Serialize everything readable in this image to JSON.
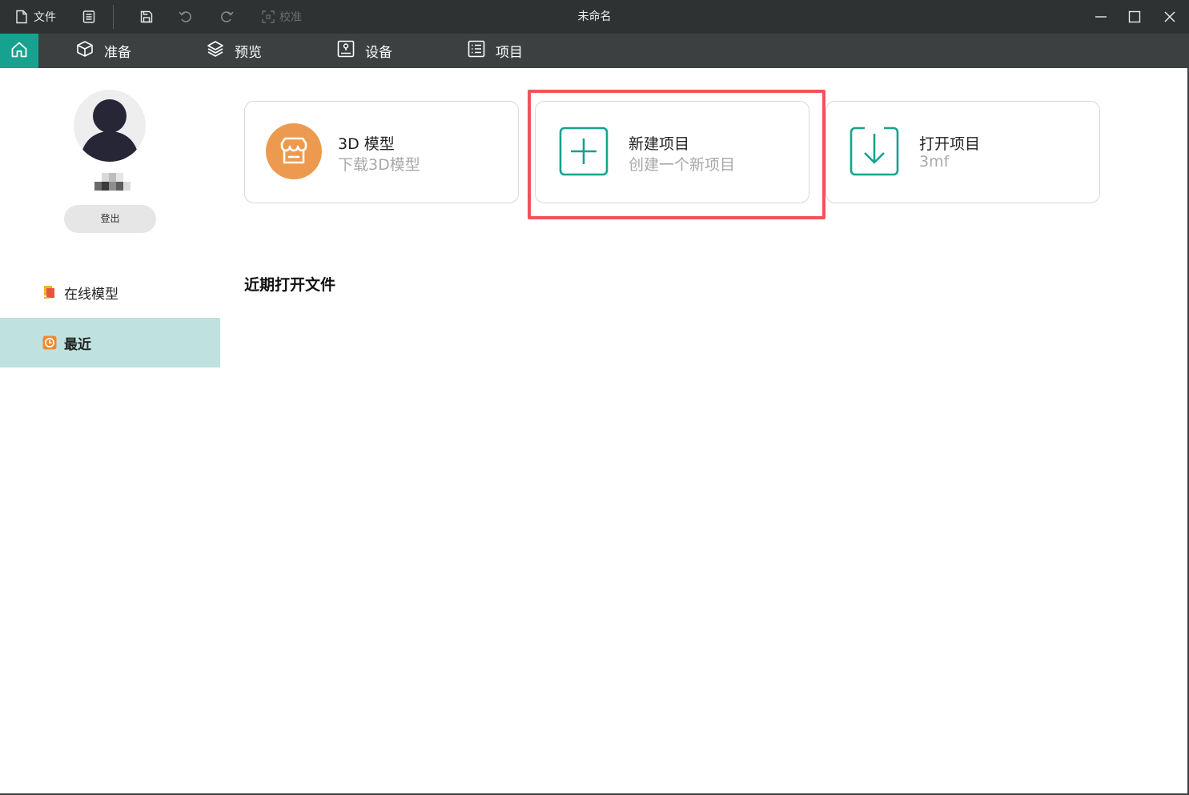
{
  "titlebar": {
    "file_label": "文件",
    "calibrate_label": "校准",
    "window_title": "未命名"
  },
  "nav": {
    "tabs": [
      {
        "label": "准备",
        "icon": "cube-icon"
      },
      {
        "label": "预览",
        "icon": "layers-icon"
      },
      {
        "label": "设备",
        "icon": "device-icon"
      },
      {
        "label": "项目",
        "icon": "list-icon"
      }
    ]
  },
  "sidebar": {
    "logout_label": "登出",
    "items": [
      {
        "label": "在线模型",
        "icon": "online-model-icon",
        "active": false
      },
      {
        "label": "最近",
        "icon": "clock-icon",
        "active": true
      }
    ]
  },
  "cards": [
    {
      "title": "3D 模型",
      "subtitle": "下载3D模型",
      "icon": "store-icon",
      "icon_color": "#ec9a4f"
    },
    {
      "title": "新建项目",
      "subtitle": "创建一个新项目",
      "icon": "plus-box-icon",
      "icon_color": "#17a28f"
    },
    {
      "title": "打开项目",
      "subtitle": "3mf",
      "icon": "download-box-icon",
      "icon_color": "#17a28f"
    }
  ],
  "recent": {
    "title": "近期打开文件"
  },
  "colors": {
    "accent": "#17a28f",
    "titlebar_bg": "#2f3233",
    "navbar_bg": "#3c4041",
    "active_item_bg": "#bfe2e0",
    "highlight": "#f0535a"
  }
}
